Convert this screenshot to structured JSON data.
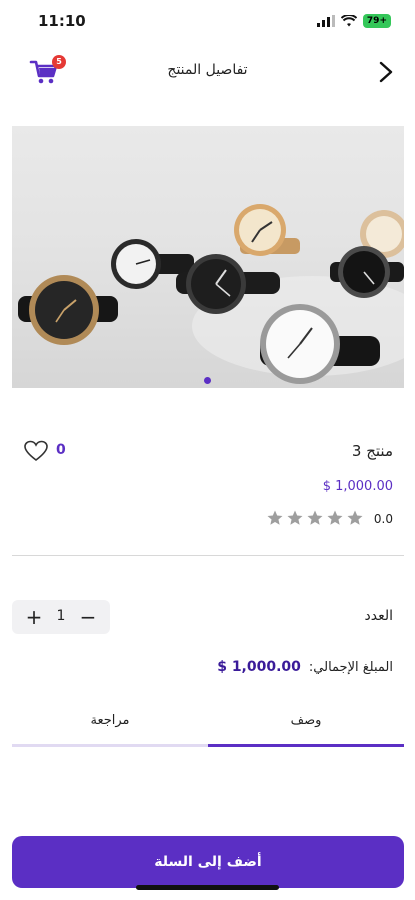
{
  "status_bar": {
    "time": "11:10",
    "battery": "79+"
  },
  "header": {
    "title": "تفاصيل المنتج",
    "cart_badge": "5"
  },
  "product": {
    "name": "منتج 3",
    "price": "1,000.00 $",
    "likes": "0",
    "rating": "0.0",
    "stars_total": 5,
    "stars_filled": 0
  },
  "quantity": {
    "label": "العدد",
    "value": "1",
    "plus": "+",
    "minus": "−"
  },
  "total": {
    "label": "المبلغ الإجمالي:",
    "amount": "$ 1,000.00"
  },
  "tabs": [
    {
      "label": "مراجعة",
      "active": false
    },
    {
      "label": "وصف",
      "active": true
    }
  ],
  "actions": {
    "add_to_cart": "أضف إلى السلة"
  },
  "colors": {
    "accent": "#5b2fc4",
    "badge": "#e53935",
    "battery": "#34c759"
  }
}
